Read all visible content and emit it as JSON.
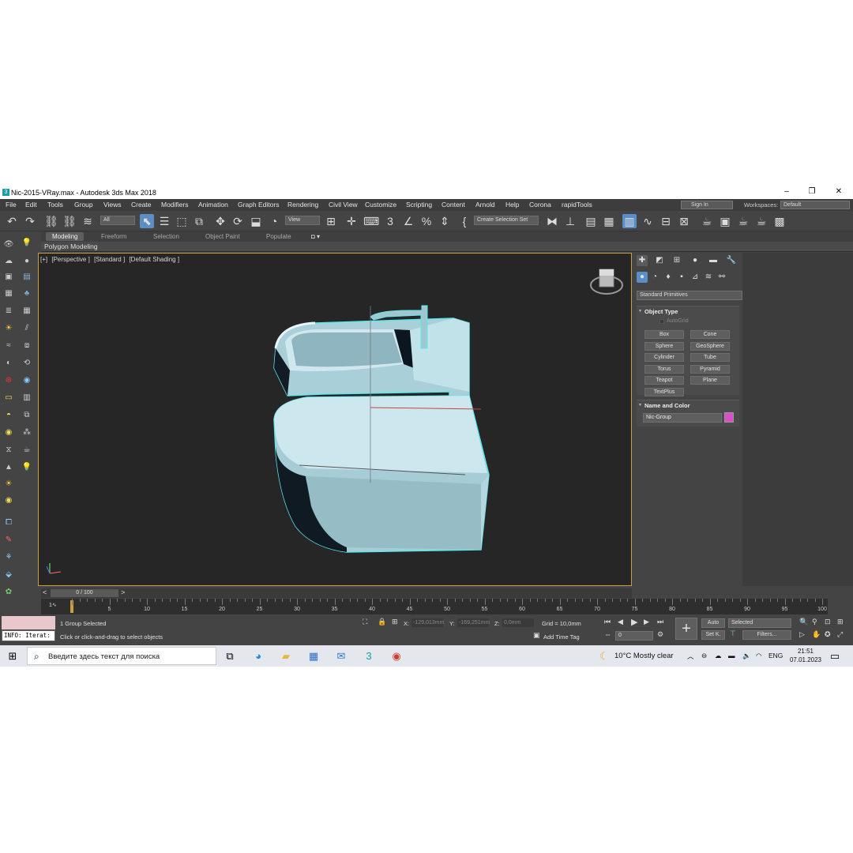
{
  "window": {
    "title": "Nic-2015-VRay.max - Autodesk 3ds Max 2018",
    "app_icon": "3"
  },
  "menu": [
    "File",
    "Edit",
    "Tools",
    "Group",
    "Views",
    "Create",
    "Modifiers",
    "Animation",
    "Graph Editors",
    "Rendering",
    "Civil View",
    "Customize",
    "Scripting",
    "Content",
    "Arnold",
    "Help",
    "Corona",
    "rapidTools"
  ],
  "account": {
    "sign_in": "Sign In",
    "workspaces_label": "Workspaces:",
    "workspace_value": "Default"
  },
  "toolbar": {
    "filter_value": "All",
    "refcoord_value": "View",
    "selection_set_placeholder": "Create Selection Set"
  },
  "ribbon": {
    "tabs": [
      "Modeling",
      "Freeform",
      "Selection",
      "Object Paint",
      "Populate"
    ],
    "active_tab": "Modeling",
    "sub_label": "Polygon Modeling"
  },
  "viewport": {
    "labels": [
      "[+]",
      "[Perspective ]",
      "[Standard ]",
      "[Default Shading ]"
    ]
  },
  "command_panel": {
    "category_value": "Standard Primitives",
    "object_type": {
      "title": "Object Type",
      "autogrid": "AutoGrid",
      "buttons": [
        "Box",
        "Cone",
        "Sphere",
        "GeoSphere",
        "Cylinder",
        "Tube",
        "Torus",
        "Pyramid",
        "Teapot",
        "Plane",
        "TextPlus"
      ]
    },
    "name_and_color": {
      "title": "Name and Color",
      "name_value": "Nic-Group",
      "color": "#d94fc8"
    }
  },
  "timeline": {
    "frame_display": "0 / 100",
    "ticks": [
      "0",
      "5",
      "10",
      "15",
      "20",
      "25",
      "30",
      "35",
      "40",
      "45",
      "50",
      "55",
      "60",
      "65",
      "70",
      "75",
      "80",
      "85",
      "90",
      "95",
      "100"
    ]
  },
  "status": {
    "info_text": "INFO: Iterat:",
    "selection_text": "1 Group Selected",
    "prompt_text": "Click or click-and-drag to select objects",
    "x_label": "X:",
    "x_value": "-129,013mm",
    "y_label": "Y:",
    "y_value": "-169,251mm",
    "z_label": "Z:",
    "z_value": "0,0mm",
    "grid_text": "Grid = 10,0mm",
    "add_time_tag": "Add Time Tag",
    "auto_key": "Auto",
    "set_key": "Set K.",
    "key_filter_value": "Selected",
    "filters": "Filters...",
    "frame_value": "0"
  },
  "taskbar": {
    "search_placeholder": "Введите здесь текст для поиска",
    "weather": "10°C  Mostly clear",
    "language": "ENG",
    "time": "21:51",
    "date": "07.01.2023"
  },
  "colors": {
    "model_fill": "#b9dde6",
    "model_outline": "#5fe6ec",
    "viewport_border": "#c8a040",
    "accent_blue": "#5b8ec7"
  }
}
